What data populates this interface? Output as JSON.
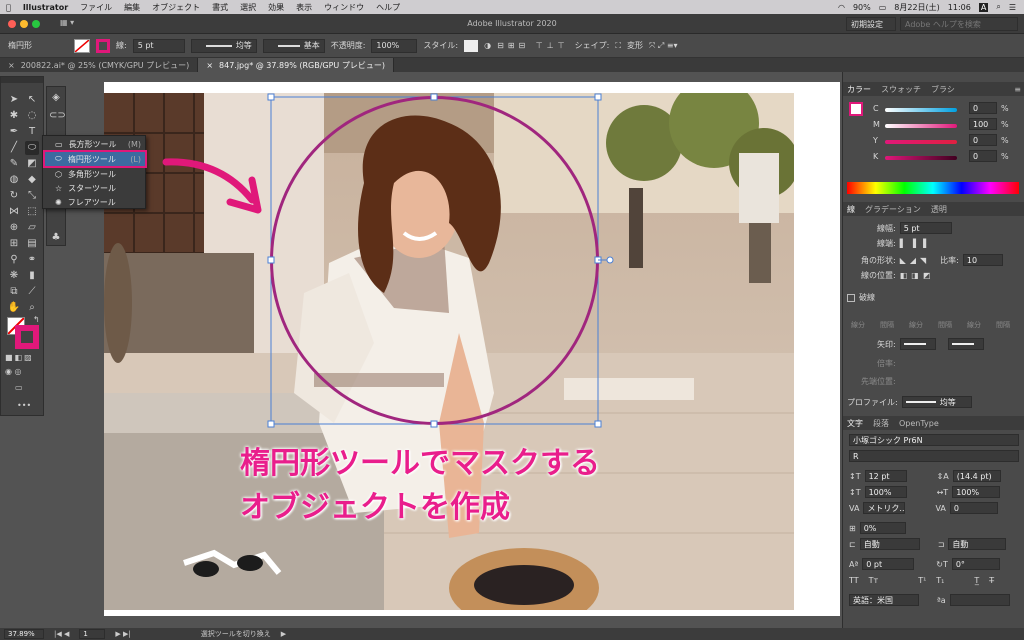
{
  "menubar": {
    "app": "Illustrator",
    "items": [
      "ファイル",
      "編集",
      "オブジェクト",
      "書式",
      "選択",
      "効果",
      "表示",
      "ウィンドウ",
      "ヘルプ"
    ],
    "battery": "90%",
    "date": "8月22日(土)",
    "time": "11:06"
  },
  "appbar": {
    "title": "Adobe Illustrator 2020",
    "workspace": "初期設定",
    "search_placeholder": "Adobe ヘルプを検索"
  },
  "control": {
    "tool_name": "楕円形",
    "stroke_label": "線:",
    "stroke_value": "5 pt",
    "profile_label": "均等",
    "brush_label": "基本",
    "opacity_label": "不透明度:",
    "opacity_value": "100%",
    "style_label": "スタイル:",
    "shape_label": "シェイプ:",
    "transform_label": "変形"
  },
  "tabs": [
    {
      "label": "200822.ai* @ 25% (CMYK/GPU プレビュー)"
    },
    {
      "label": "847.jpg* @ 37.89% (RGB/GPU プレビュー)"
    }
  ],
  "flyout": [
    {
      "label": "長方形ツール",
      "shortcut": "(M)"
    },
    {
      "label": "楕円形ツール",
      "shortcut": "(L)"
    },
    {
      "label": "多角形ツール",
      "shortcut": ""
    },
    {
      "label": "スターツール",
      "shortcut": ""
    },
    {
      "label": "フレアツール",
      "shortcut": ""
    }
  ],
  "caption": {
    "line1": "楕円形ツールでマスクする",
    "line2": "オブジェクトを作成"
  },
  "color_panel": {
    "tabs": [
      "カラー",
      "スウォッチ",
      "ブラシ"
    ],
    "channels": [
      {
        "label": "C",
        "value": "0",
        "unit": "%"
      },
      {
        "label": "M",
        "value": "100",
        "unit": "%"
      },
      {
        "label": "Y",
        "value": "0",
        "unit": "%"
      },
      {
        "label": "K",
        "value": "0",
        "unit": "%"
      }
    ]
  },
  "stroke_panel": {
    "tabs": [
      "線",
      "グラデーション",
      "透明"
    ],
    "weight_label": "線幅:",
    "weight_value": "5 pt",
    "cap_label": "線端:",
    "corner_label": "角の形状:",
    "ratio_label": "比率:",
    "ratio_value": "10",
    "align_label": "線の位置:",
    "dashed_label": "破線",
    "dash_labels": [
      "線分",
      "間隔",
      "線分",
      "間隔",
      "線分",
      "間隔"
    ],
    "arrow_label": "矢印:",
    "scale_label": "倍率:",
    "arrow_pos_label": "先端位置:",
    "profile_label": "プロファイル:",
    "profile_value": "均等"
  },
  "char_panel": {
    "tabs": [
      "文字",
      "段落",
      "OpenType"
    ],
    "font": "小塚ゴシック Pr6N",
    "style": "R",
    "size": "12 pt",
    "leading": "(14.4 pt)",
    "vscale": "100%",
    "hscale": "100%",
    "kerning": "メトリク..",
    "tracking": "0",
    "tsume": "0%",
    "auto1": "自動",
    "auto2": "自動",
    "baseline": "0 pt",
    "rotation": "0°",
    "language": "英語：米国",
    "aa": "ªa"
  },
  "status": {
    "zoom": "37.89%",
    "artboard": "1",
    "message": "選択ツールを切り換え"
  },
  "colors": {
    "magenta": "#e0187a",
    "ui_dark": "#3c3c3c"
  }
}
